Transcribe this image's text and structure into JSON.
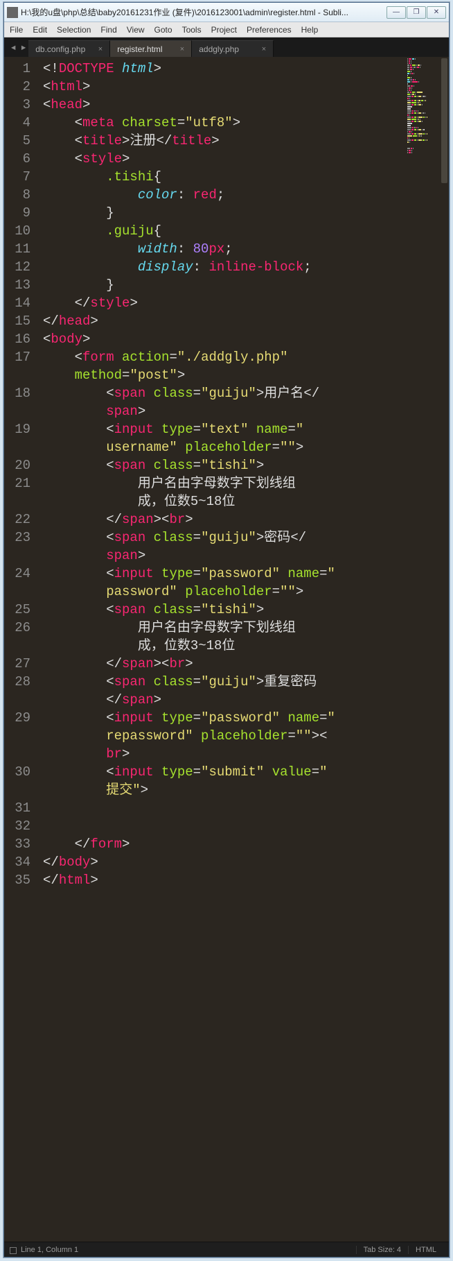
{
  "window": {
    "title": "H:\\我的u盘\\php\\总结\\baby20161231作业 (复件)\\2016123001\\admin\\register.html - Subli..."
  },
  "menu": {
    "items": [
      "File",
      "Edit",
      "Selection",
      "Find",
      "View",
      "Goto",
      "Tools",
      "Project",
      "Preferences",
      "Help"
    ]
  },
  "tabs": [
    {
      "label": "db.config.php",
      "active": false
    },
    {
      "label": "register.html",
      "active": true
    },
    {
      "label": "addgly.php",
      "active": false
    }
  ],
  "status": {
    "left": "Line 1, Column 1",
    "tab_size": "Tab Size: 4",
    "lang": "HTML"
  },
  "code": {
    "lines": [
      {
        "n": "1",
        "tokens": [
          [
            "p",
            "<!"
          ],
          [
            "doctype",
            "DOCTYPE"
          ],
          [
            "p",
            " "
          ],
          [
            "doctype-kw",
            "html"
          ],
          [
            "p",
            ">"
          ]
        ]
      },
      {
        "n": "2",
        "tokens": [
          [
            "p",
            "<"
          ],
          [
            "tag",
            "html"
          ],
          [
            "p",
            ">"
          ]
        ]
      },
      {
        "n": "3",
        "tokens": [
          [
            "p",
            "<"
          ],
          [
            "tag",
            "head"
          ],
          [
            "p",
            ">"
          ]
        ]
      },
      {
        "n": "4",
        "tokens": [
          [
            "p",
            "    <"
          ],
          [
            "tag",
            "meta"
          ],
          [
            "p",
            " "
          ],
          [
            "attr",
            "charset"
          ],
          [
            "p",
            "="
          ],
          [
            "str",
            "\"utf8\""
          ],
          [
            "p",
            ">"
          ]
        ]
      },
      {
        "n": "5",
        "tokens": [
          [
            "p",
            "    <"
          ],
          [
            "tag",
            "title"
          ],
          [
            "p",
            ">"
          ],
          [
            "txt",
            "注册"
          ],
          [
            "p",
            "</"
          ],
          [
            "tag",
            "title"
          ],
          [
            "p",
            ">"
          ]
        ]
      },
      {
        "n": "6",
        "tokens": [
          [
            "p",
            "    <"
          ],
          [
            "tag",
            "style"
          ],
          [
            "p",
            ">"
          ]
        ]
      },
      {
        "n": "7",
        "tokens": [
          [
            "p",
            "        "
          ],
          [
            "sel",
            ".tishi"
          ],
          [
            "brace",
            "{"
          ]
        ]
      },
      {
        "n": "8",
        "tokens": [
          [
            "p",
            "            "
          ],
          [
            "prop",
            "color"
          ],
          [
            "p",
            ": "
          ],
          [
            "val",
            "red"
          ],
          [
            "p",
            ";"
          ]
        ]
      },
      {
        "n": "9",
        "tokens": [
          [
            "p",
            "        "
          ],
          [
            "brace",
            "}"
          ]
        ]
      },
      {
        "n": "10",
        "tokens": [
          [
            "p",
            "        "
          ],
          [
            "sel",
            ".guiju"
          ],
          [
            "brace",
            "{"
          ]
        ]
      },
      {
        "n": "11",
        "tokens": [
          [
            "p",
            "            "
          ],
          [
            "prop",
            "width"
          ],
          [
            "p",
            ": "
          ],
          [
            "num",
            "80"
          ],
          [
            "unit",
            "px"
          ],
          [
            "p",
            ";"
          ]
        ]
      },
      {
        "n": "12",
        "tokens": [
          [
            "p",
            "            "
          ],
          [
            "prop",
            "display"
          ],
          [
            "p",
            ": "
          ],
          [
            "val",
            "inline-block"
          ],
          [
            "p",
            ";"
          ]
        ]
      },
      {
        "n": "13",
        "tokens": [
          [
            "p",
            "        "
          ],
          [
            "brace",
            "}"
          ]
        ]
      },
      {
        "n": "14",
        "tokens": [
          [
            "p",
            "    </"
          ],
          [
            "tag",
            "style"
          ],
          [
            "p",
            ">"
          ]
        ]
      },
      {
        "n": "15",
        "tokens": [
          [
            "p",
            "</"
          ],
          [
            "tag",
            "head"
          ],
          [
            "p",
            ">"
          ]
        ]
      },
      {
        "n": "16",
        "tokens": [
          [
            "p",
            "<"
          ],
          [
            "tag",
            "body"
          ],
          [
            "p",
            ">"
          ]
        ]
      },
      {
        "n": "17",
        "tokens": [
          [
            "p",
            "    <"
          ],
          [
            "tag",
            "form"
          ],
          [
            "p",
            " "
          ],
          [
            "attr",
            "action"
          ],
          [
            "p",
            "="
          ],
          [
            "str",
            "\"./addgly.php\""
          ],
          [
            "p",
            " "
          ]
        ],
        "wrap": [
          [
            "attr",
            "method"
          ],
          [
            "p",
            "="
          ],
          [
            "str",
            "\"post\""
          ],
          [
            "p",
            ">"
          ]
        ],
        "wrapIndent": "    "
      },
      {
        "n": "18",
        "tokens": [
          [
            "p",
            "        <"
          ],
          [
            "tag",
            "span"
          ],
          [
            "p",
            " "
          ],
          [
            "attr",
            "class"
          ],
          [
            "p",
            "="
          ],
          [
            "str",
            "\"guiju\""
          ],
          [
            "p",
            ">"
          ],
          [
            "txt",
            "用户名"
          ],
          [
            "p",
            "</"
          ]
        ],
        "wrap": [
          [
            "tag",
            "span"
          ],
          [
            "p",
            ">"
          ]
        ],
        "wrapIndent": "        "
      },
      {
        "n": "19",
        "tokens": [
          [
            "p",
            "        <"
          ],
          [
            "tag",
            "input"
          ],
          [
            "p",
            " "
          ],
          [
            "attr",
            "type"
          ],
          [
            "p",
            "="
          ],
          [
            "str",
            "\"text\""
          ],
          [
            "p",
            " "
          ],
          [
            "attr",
            "name"
          ],
          [
            "p",
            "="
          ],
          [
            "str",
            "\""
          ]
        ],
        "wrap": [
          [
            "str",
            "username\""
          ],
          [
            "p",
            " "
          ],
          [
            "attr",
            "placeholder"
          ],
          [
            "p",
            "="
          ],
          [
            "str",
            "\"\""
          ],
          [
            "p",
            ">"
          ]
        ],
        "wrapIndent": "        "
      },
      {
        "n": "20",
        "tokens": [
          [
            "p",
            "        <"
          ],
          [
            "tag",
            "span"
          ],
          [
            "p",
            " "
          ],
          [
            "attr",
            "class"
          ],
          [
            "p",
            "="
          ],
          [
            "str",
            "\"tishi\""
          ],
          [
            "p",
            ">"
          ]
        ]
      },
      {
        "n": "21",
        "tokens": [
          [
            "p",
            "            "
          ],
          [
            "txt",
            "用户名由字母数字下划线组"
          ]
        ],
        "wrap": [
          [
            "txt",
            "成，位数5~18位"
          ]
        ],
        "wrapIndent": "            "
      },
      {
        "n": "22",
        "tokens": [
          [
            "p",
            "        </"
          ],
          [
            "tag",
            "span"
          ],
          [
            "p",
            "><"
          ],
          [
            "tag",
            "br"
          ],
          [
            "p",
            ">"
          ]
        ]
      },
      {
        "n": "23",
        "tokens": [
          [
            "p",
            "        <"
          ],
          [
            "tag",
            "span"
          ],
          [
            "p",
            " "
          ],
          [
            "attr",
            "class"
          ],
          [
            "p",
            "="
          ],
          [
            "str",
            "\"guiju\""
          ],
          [
            "p",
            ">"
          ],
          [
            "txt",
            "密码"
          ],
          [
            "p",
            "</"
          ]
        ],
        "wrap": [
          [
            "tag",
            "span"
          ],
          [
            "p",
            ">"
          ]
        ],
        "wrapIndent": "        "
      },
      {
        "n": "24",
        "tokens": [
          [
            "p",
            "        <"
          ],
          [
            "tag",
            "input"
          ],
          [
            "p",
            " "
          ],
          [
            "attr",
            "type"
          ],
          [
            "p",
            "="
          ],
          [
            "str",
            "\"password\""
          ],
          [
            "p",
            " "
          ],
          [
            "attr",
            "name"
          ],
          [
            "p",
            "="
          ],
          [
            "str",
            "\""
          ]
        ],
        "wrap": [
          [
            "str",
            "password\""
          ],
          [
            "p",
            " "
          ],
          [
            "attr",
            "placeholder"
          ],
          [
            "p",
            "="
          ],
          [
            "str",
            "\"\""
          ],
          [
            "p",
            ">"
          ]
        ],
        "wrapIndent": "        "
      },
      {
        "n": "25",
        "tokens": [
          [
            "p",
            "        <"
          ],
          [
            "tag",
            "span"
          ],
          [
            "p",
            " "
          ],
          [
            "attr",
            "class"
          ],
          [
            "p",
            "="
          ],
          [
            "str",
            "\"tishi\""
          ],
          [
            "p",
            ">"
          ]
        ]
      },
      {
        "n": "26",
        "tokens": [
          [
            "p",
            "            "
          ],
          [
            "txt",
            "用户名由字母数字下划线组"
          ]
        ],
        "wrap": [
          [
            "txt",
            "成，位数3~18位"
          ]
        ],
        "wrapIndent": "            "
      },
      {
        "n": "27",
        "tokens": [
          [
            "p",
            "        </"
          ],
          [
            "tag",
            "span"
          ],
          [
            "p",
            "><"
          ],
          [
            "tag",
            "br"
          ],
          [
            "p",
            ">"
          ]
        ]
      },
      {
        "n": "28",
        "tokens": [
          [
            "p",
            "        <"
          ],
          [
            "tag",
            "span"
          ],
          [
            "p",
            " "
          ],
          [
            "attr",
            "class"
          ],
          [
            "p",
            "="
          ],
          [
            "str",
            "\"guiju\""
          ],
          [
            "p",
            ">"
          ],
          [
            "txt",
            "重复密码"
          ]
        ],
        "wrap": [
          [
            "p",
            "</"
          ],
          [
            "tag",
            "span"
          ],
          [
            "p",
            ">"
          ]
        ],
        "wrapIndent": "        "
      },
      {
        "n": "29",
        "tokens": [
          [
            "p",
            "        <"
          ],
          [
            "tag",
            "input"
          ],
          [
            "p",
            " "
          ],
          [
            "attr",
            "type"
          ],
          [
            "p",
            "="
          ],
          [
            "str",
            "\"password\""
          ],
          [
            "p",
            " "
          ],
          [
            "attr",
            "name"
          ],
          [
            "p",
            "="
          ],
          [
            "str",
            "\""
          ]
        ],
        "wrap": [
          [
            "str",
            "repassword\""
          ],
          [
            "p",
            " "
          ],
          [
            "attr",
            "placeholder"
          ],
          [
            "p",
            "="
          ],
          [
            "str",
            "\"\""
          ],
          [
            "p",
            "><"
          ]
        ],
        "wrap2": [
          [
            "tag",
            "br"
          ],
          [
            "p",
            ">"
          ]
        ],
        "wrapIndent": "        "
      },
      {
        "n": "30",
        "tokens": [
          [
            "p",
            "        <"
          ],
          [
            "tag",
            "input"
          ],
          [
            "p",
            " "
          ],
          [
            "attr",
            "type"
          ],
          [
            "p",
            "="
          ],
          [
            "str",
            "\"submit\""
          ],
          [
            "p",
            " "
          ],
          [
            "attr",
            "value"
          ],
          [
            "p",
            "="
          ],
          [
            "str",
            "\""
          ]
        ],
        "wrap": [
          [
            "str",
            "提交\""
          ],
          [
            "p",
            ">"
          ]
        ],
        "wrapIndent": "        "
      },
      {
        "n": "31",
        "tokens": [
          [
            "p",
            ""
          ]
        ]
      },
      {
        "n": "32",
        "tokens": [
          [
            "p",
            ""
          ]
        ]
      },
      {
        "n": "33",
        "tokens": [
          [
            "p",
            "    </"
          ],
          [
            "tag",
            "form"
          ],
          [
            "p",
            ">"
          ]
        ]
      },
      {
        "n": "34",
        "tokens": [
          [
            "p",
            "</"
          ],
          [
            "tag",
            "body"
          ],
          [
            "p",
            ">"
          ]
        ]
      },
      {
        "n": "35",
        "tokens": [
          [
            "p",
            "</"
          ],
          [
            "tag",
            "html"
          ],
          [
            "p",
            ">"
          ]
        ]
      }
    ]
  }
}
